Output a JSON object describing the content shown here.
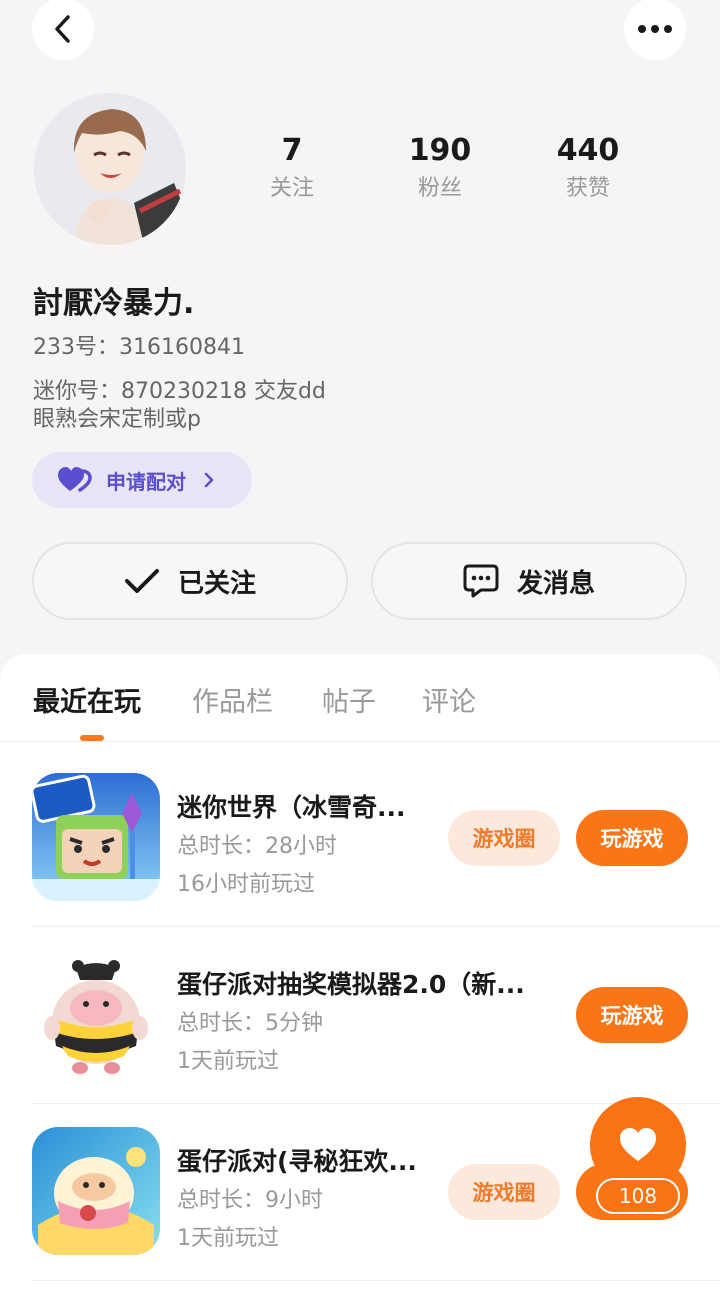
{
  "header": {
    "back_icon": "chevron-left-icon",
    "more_icon": "more-dots-icon"
  },
  "profile": {
    "stats": [
      {
        "value": "7",
        "label": "关注"
      },
      {
        "value": "190",
        "label": "粉丝"
      },
      {
        "value": "440",
        "label": "获赞"
      }
    ],
    "nickname": "討厭冷暴力.",
    "id_233": "233号：316160841",
    "bio_line1": "迷你号：870230218 交友dd",
    "bio_line2": "眼熟会宋定制或p",
    "pair_label": "申请配对",
    "follow_label": "已关注",
    "message_label": "发消息"
  },
  "tabs": [
    "最近在玩",
    "作品栏",
    "帖子",
    "评论"
  ],
  "games": [
    {
      "title": "迷你世界（冰雪奇...",
      "duration": "总时长：28小时",
      "last_played": "16小时前玩过",
      "circle_label": "游戏圈",
      "play_label": "玩游戏"
    },
    {
      "title": "蛋仔派对抽奖模拟器2.0（新...",
      "duration": "总时长：5分钟",
      "last_played": "1天前玩过",
      "play_label": "玩游戏"
    },
    {
      "title": "蛋仔派对(寻秘狂欢...",
      "duration": "总时长：9小时",
      "last_played": "1天前玩过",
      "circle_label": "游戏圈"
    }
  ],
  "fab": {
    "count": "108"
  },
  "colors": {
    "accent": "#fa7516",
    "pair_purple": "#5b4fd1"
  }
}
